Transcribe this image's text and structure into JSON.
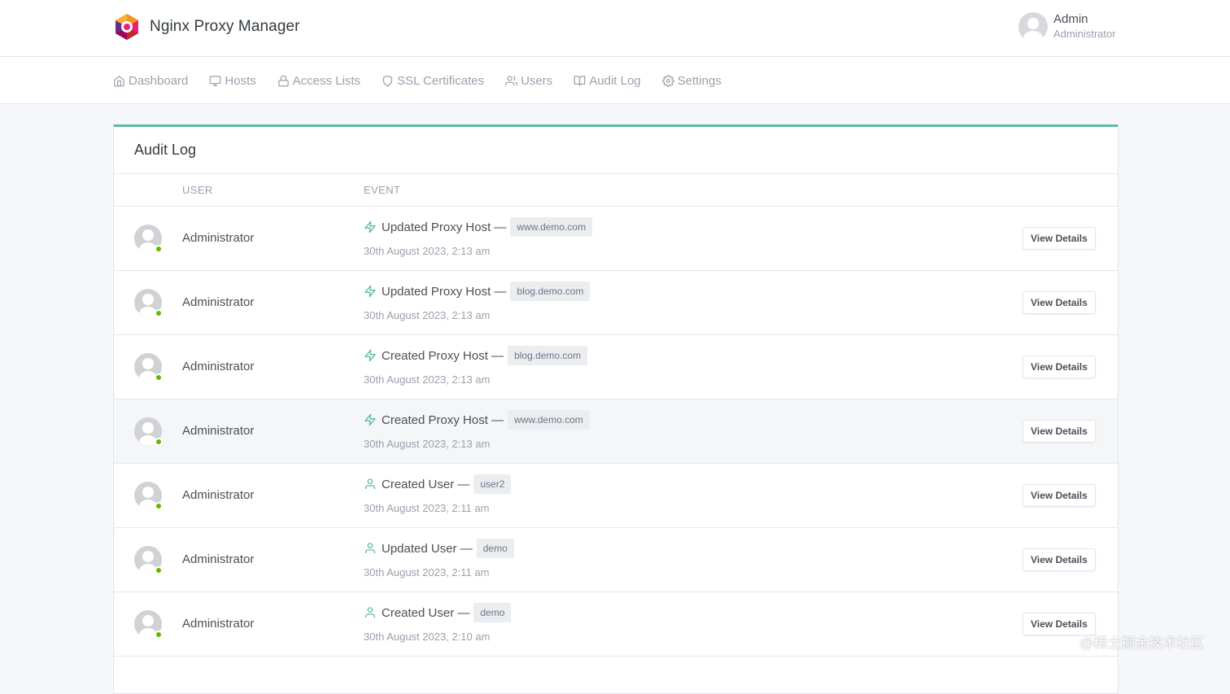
{
  "header": {
    "app_title": "Nginx Proxy Manager",
    "user_name": "Admin",
    "user_role": "Administrator"
  },
  "nav": {
    "items": [
      {
        "label": "Dashboard",
        "icon": "home-icon"
      },
      {
        "label": "Hosts",
        "icon": "monitor-icon"
      },
      {
        "label": "Access Lists",
        "icon": "lock-icon"
      },
      {
        "label": "SSL Certificates",
        "icon": "shield-icon"
      },
      {
        "label": "Users",
        "icon": "users-icon"
      },
      {
        "label": "Audit Log",
        "icon": "book-icon"
      },
      {
        "label": "Settings",
        "icon": "gear-icon"
      }
    ]
  },
  "audit": {
    "title": "Audit Log",
    "columns": {
      "user": "USER",
      "event": "EVENT"
    },
    "view_label": "View Details",
    "rows": [
      {
        "user": "Administrator",
        "event": "Updated Proxy Host —",
        "tag": "www.demo.com",
        "date": "30th August 2023, 2:13 am",
        "icon": "lightning-icon"
      },
      {
        "user": "Administrator",
        "event": "Updated Proxy Host —",
        "tag": "blog.demo.com",
        "date": "30th August 2023, 2:13 am",
        "icon": "lightning-icon"
      },
      {
        "user": "Administrator",
        "event": "Created Proxy Host —",
        "tag": "blog.demo.com",
        "date": "30th August 2023, 2:13 am",
        "icon": "lightning-icon"
      },
      {
        "user": "Administrator",
        "event": "Created Proxy Host —",
        "tag": "www.demo.com",
        "date": "30th August 2023, 2:13 am",
        "icon": "lightning-icon"
      },
      {
        "user": "Administrator",
        "event": "Created User —",
        "tag": "user2",
        "date": "30th August 2023, 2:11 am",
        "icon": "user-icon"
      },
      {
        "user": "Administrator",
        "event": "Updated User —",
        "tag": "demo",
        "date": "30th August 2023, 2:11 am",
        "icon": "user-icon"
      },
      {
        "user": "Administrator",
        "event": "Created User —",
        "tag": "demo",
        "date": "30th August 2023, 2:10 am",
        "icon": "user-icon"
      }
    ]
  },
  "watermark": "@稀土掘金技术社区",
  "colors": {
    "accent": "#5eba9f",
    "online": "#5eba00",
    "page_bg": "#f5f7fb"
  }
}
